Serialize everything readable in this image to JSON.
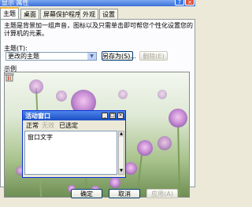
{
  "window": {
    "title": "显示 属性",
    "help_label": "?",
    "close_label": "×"
  },
  "tabs": [
    "主题",
    "桌面",
    "屏幕保护程序",
    "外观",
    "设置"
  ],
  "active_tab": "主题",
  "themes_panel": {
    "description": "主题是背景加一组声音，图标以及只需单击即可帮您个性化设置您的计算机的元素。",
    "theme_label": "主题(T):",
    "theme_value": "更改的主题",
    "save_as_label": "另存为(S)...",
    "delete_label": "删除(E)",
    "preview_label": "示例"
  },
  "sample_window": {
    "title": "活动窗口",
    "menu": [
      "正常",
      "无效",
      "已选定"
    ],
    "text": "窗口文字"
  },
  "footer": {
    "ok_label": "确定",
    "cancel_label": "取消",
    "apply_label": "应用(A)"
  },
  "colors": {
    "title_bar": "#3a6fd8",
    "dialog_bg": "#ece9d8",
    "sample_title": "#1b4fc4"
  }
}
